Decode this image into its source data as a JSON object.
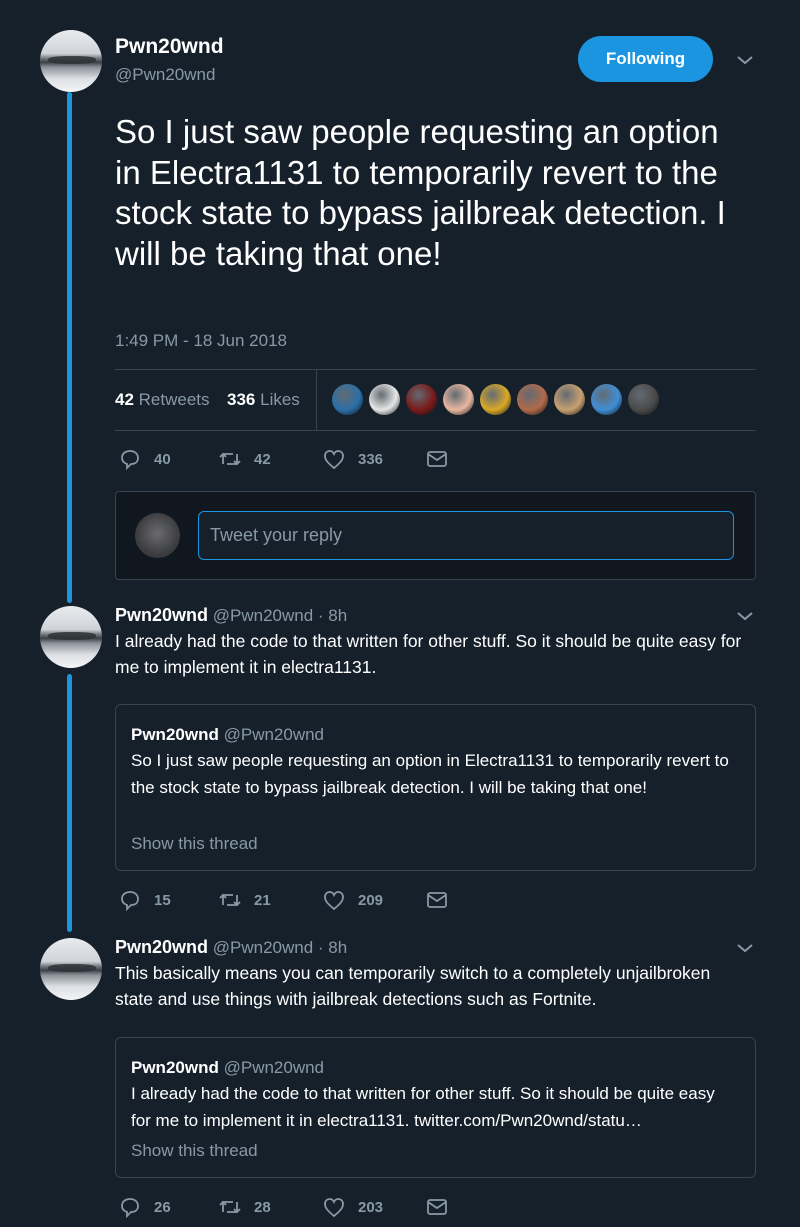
{
  "main_tweet": {
    "name": "Pwn20wnd",
    "handle": "@Pwn20wnd",
    "follow_label": "Following",
    "text": "So I just saw people requesting an option in Electra1131 to temporarily revert to the stock state to bypass jailbreak detection. I will be taking that one!",
    "timestamp": "1:49 PM - 18 Jun 2018",
    "retweets_count": "42",
    "retweets_label": "Retweets",
    "likes_count": "336",
    "likes_label": "Likes",
    "liker_avatar_colors": [
      "#2a6fa8",
      "#e6e6e6",
      "#7a1a1a",
      "#e8b8a0",
      "#d9a826",
      "#b06a4a",
      "#c8a070",
      "#3f8ed6",
      "#4a4a4a"
    ],
    "actions": {
      "replies": "40",
      "retweets": "42",
      "likes": "336"
    }
  },
  "reply_box": {
    "placeholder": "Tweet your reply"
  },
  "thread": [
    {
      "name": "Pwn20wnd",
      "handle": "@Pwn20wnd",
      "time": "· 8h",
      "text": "I already had the code to that written for other stuff. So it should be quite easy for me to implement it in electra1131.",
      "quote": {
        "name": "Pwn20wnd",
        "handle": "@Pwn20wnd",
        "text": "So I just saw people requesting an option in Electra1131 to temporarily revert to the stock state to bypass jailbreak detection. I will be taking that one!",
        "show_thread": "Show this thread"
      },
      "actions": {
        "replies": "15",
        "retweets": "21",
        "likes": "209"
      }
    },
    {
      "name": "Pwn20wnd",
      "handle": "@Pwn20wnd",
      "time": "· 8h",
      "text": "This basically means you can temporarily switch to a completely unjailbroken state and use things with jailbreak detections such as Fortnite.",
      "quote": {
        "name": "Pwn20wnd",
        "handle": "@Pwn20wnd",
        "text": "I already had the code to that written for other stuff. So it should be quite easy for me to implement it in electra1131. twitter.com/Pwn20wnd/statu…",
        "show_thread": "Show this thread"
      },
      "actions": {
        "replies": "26",
        "retweets": "28",
        "likes": "203"
      }
    }
  ],
  "colors": {
    "background": "#15202b",
    "accent": "#1b95e0",
    "muted": "#8899a6",
    "border": "#38444d"
  },
  "icons": [
    "reply-icon",
    "retweet-icon",
    "like-icon",
    "message-icon",
    "chevron-down-icon"
  ]
}
